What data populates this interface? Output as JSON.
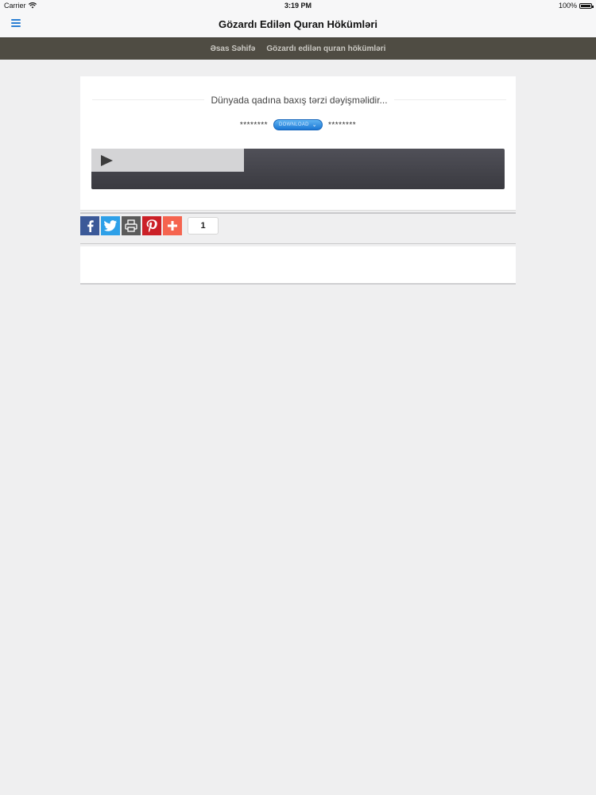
{
  "status_bar": {
    "carrier": "Carrier",
    "time": "3:19 PM",
    "battery": "100%"
  },
  "header": {
    "title": "Gözardı Edilən Quran Hökümləri",
    "menu_icon": "hamburger-menu-icon"
  },
  "breadcrumb": {
    "items": [
      "Əsas Səhifə",
      "Gözardı edilən quran hökümləri"
    ]
  },
  "article": {
    "title": "Dünyada qadına baxış tərzi dəyişməlidir...",
    "stars_left": "********",
    "download_label": "DOWNLOAD",
    "stars_right": "********"
  },
  "audio_player": {
    "progress": 0.37
  },
  "share": {
    "buttons": [
      "facebook-icon",
      "twitter-icon",
      "print-icon",
      "pinterest-icon",
      "add-icon"
    ],
    "count": "1"
  },
  "colors": {
    "accent": "#2b7fd3",
    "breadcrumb_bg": "#4f4c43",
    "facebook": "#3b5998",
    "twitter": "#2ea0e8",
    "pinterest": "#cb2027",
    "addthis": "#f5644f"
  }
}
